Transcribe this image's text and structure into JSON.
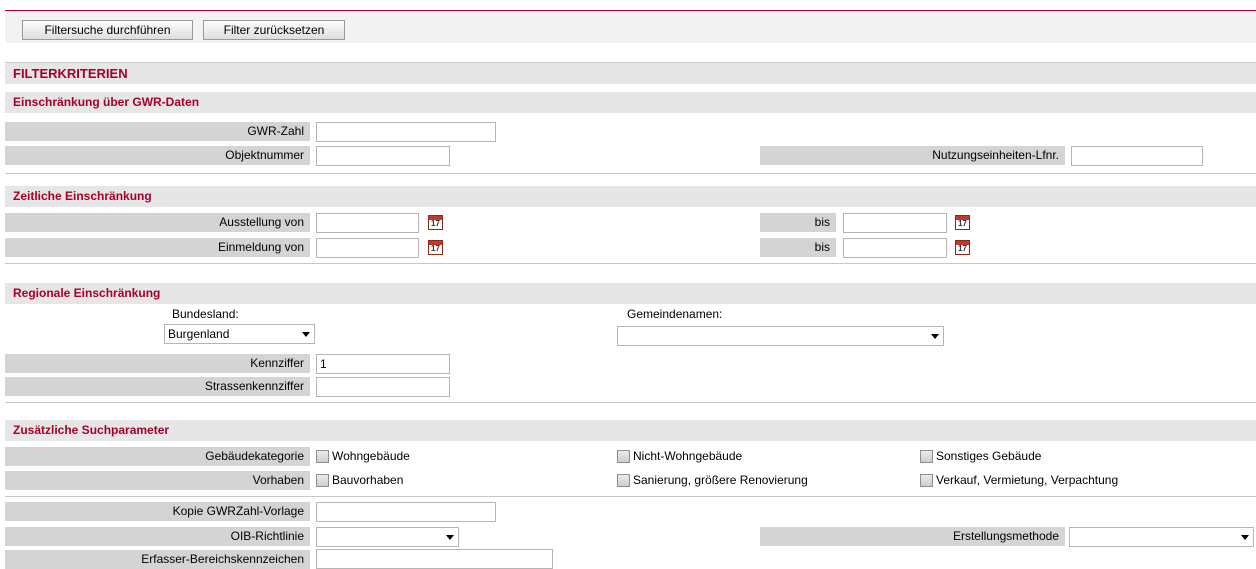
{
  "toolbar": {
    "search_label": "Filtersuche durchführen",
    "reset_label": "Filter zurücksetzen"
  },
  "main_header": "FILTERKRITERIEN",
  "gwr_section": {
    "title": "Einschränkung über GWR-Daten",
    "gwr_zahl_label": "GWR-Zahl",
    "gwr_zahl_value": "",
    "objektnummer_label": "Objektnummer",
    "objektnummer_value": "",
    "nutzungseinheiten_label": "Nutzungseinheiten-Lfnr.",
    "nutzungseinheiten_value": ""
  },
  "zeit_section": {
    "title": "Zeitliche Einschränkung",
    "ausstellung_label": "Ausstellung von",
    "ausstellung_from": "",
    "ausstellung_bis_label": "bis",
    "ausstellung_to": "",
    "einmeldung_label": "Einmeldung von",
    "einmeldung_from": "",
    "einmeldung_bis_label": "bis",
    "einmeldung_to": "",
    "calendar_day": "17"
  },
  "regional_section": {
    "title": "Regionale Einschränkung",
    "bundesland_label": "Bundesland:",
    "bundesland_value": "Burgenland",
    "gemeinde_label": "Gemeindenamen:",
    "gemeinde_value": "",
    "kennziffer_label": "Kennziffer",
    "kennziffer_value": "1",
    "strassen_label": "Strassenkennziffer",
    "strassen_value": ""
  },
  "extra_section": {
    "title": "Zusätzliche Suchparameter",
    "kategorie_label": "Gebäudekategorie",
    "kategorie_options": [
      "Wohngebäude",
      "Nicht-Wohngebäude",
      "Sonstiges Gebäude"
    ],
    "vorhaben_label": "Vorhaben",
    "vorhaben_options": [
      "Bauvorhaben",
      "Sanierung, größere Renovierung",
      "Verkauf, Vermietung, Verpachtung"
    ],
    "kopie_label": "Kopie GWRZahl-Vorlage",
    "kopie_value": "",
    "oib_label": "OIB-Richtlinie",
    "oib_value": "",
    "erstellung_label": "Erstellungsmethode",
    "erstellung_value": "",
    "erfasser_label": "Erfasser-Bereichskennzeichen",
    "erfasser_value": ""
  }
}
